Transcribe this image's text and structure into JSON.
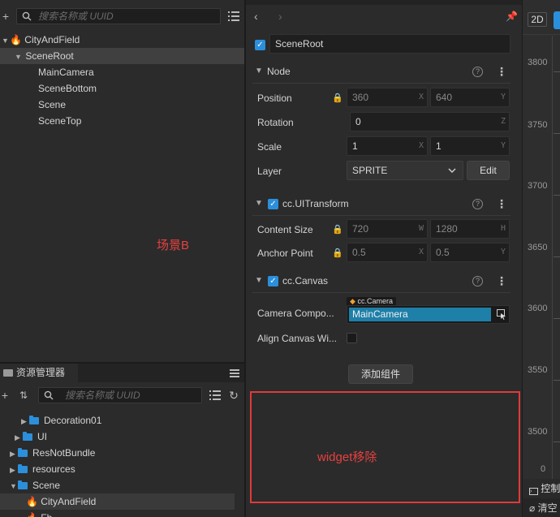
{
  "hierarchy": {
    "search_placeholder": "搜索名称或 UUID",
    "nodes": [
      {
        "label": "CityAndField"
      },
      {
        "label": "SceneRoot"
      },
      {
        "label": "MainCamera"
      },
      {
        "label": "SceneBottom"
      },
      {
        "label": "Scene"
      },
      {
        "label": "SceneTop"
      }
    ],
    "annotation": "场景B"
  },
  "assets": {
    "tab_label": "资源管理器",
    "search_placeholder": "搜索名称或 UUID",
    "items": [
      {
        "label": "Decoration01"
      },
      {
        "label": "UI"
      },
      {
        "label": "ResNotBundle"
      },
      {
        "label": "resources"
      },
      {
        "label": "Scene"
      },
      {
        "label": "CityAndField"
      },
      {
        "label": "Fb"
      }
    ]
  },
  "inspector": {
    "node_name": "SceneRoot",
    "node_section": {
      "title": "Node",
      "position_label": "Position",
      "position_x": "360",
      "position_y": "640",
      "rotation_label": "Rotation",
      "rotation_z": "0",
      "scale_label": "Scale",
      "scale_x": "1",
      "scale_y": "1",
      "layer_label": "Layer",
      "layer_value": "SPRITE",
      "edit_label": "Edit",
      "axis_x": "X",
      "axis_y": "Y",
      "axis_z": "Z"
    },
    "uitransform": {
      "title": "cc.UITransform",
      "content_size_label": "Content Size",
      "width": "720",
      "height": "1280",
      "anchor_label": "Anchor Point",
      "anchor_x": "0.5",
      "anchor_y": "0.5",
      "axis_w": "W",
      "axis_h": "H"
    },
    "canvas": {
      "title": "cc.Canvas",
      "camera_label": "Camera Compo...",
      "camera_tag": "cc.Camera",
      "camera_value": "MainCamera",
      "align_label": "Align Canvas Wi..."
    },
    "add_component_label": "添加组件",
    "annotation": "widget移除"
  },
  "scene_view": {
    "mode_label": "2D",
    "ruler": [
      "3800",
      "3750",
      "3700",
      "3650",
      "3600",
      "3550",
      "3500",
      "0"
    ],
    "console_label": "控制",
    "clear_label": "清空"
  },
  "colors": {
    "accent": "#2b8fdc",
    "annotation": "#e84040",
    "selection": "#1e7fa8"
  }
}
